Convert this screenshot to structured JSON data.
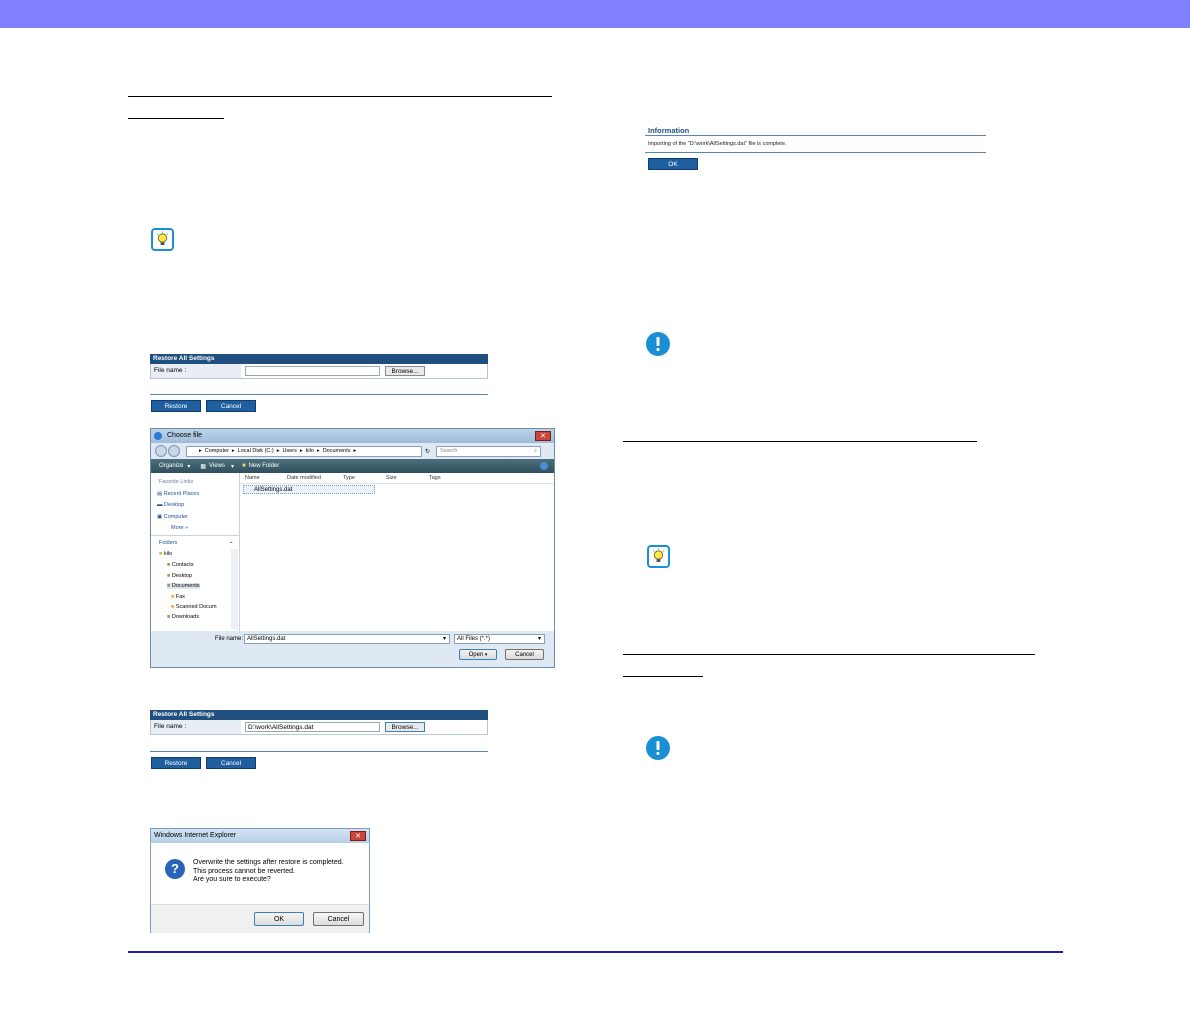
{
  "restore_panel_1": {
    "title": "Restore All Settings",
    "file_label": "File name :",
    "file_value": "",
    "browse": "Browse...",
    "restore": "Restore",
    "cancel": "Cancel"
  },
  "restore_panel_2": {
    "title": "Restore All Settings",
    "file_label": "File name :",
    "file_value": "D:\\work\\AllSettings.dat",
    "browse": "Browse...",
    "restore": "Restore",
    "cancel": "Cancel"
  },
  "file_dialog": {
    "title": "Choose file",
    "address": [
      "Computer",
      "Local Disk (C:)",
      "Users",
      "kilo",
      "Documents"
    ],
    "search_placeholder": "Search",
    "toolbar": {
      "organize": "Organize",
      "views": "Views",
      "new_folder": "New Folder"
    },
    "favorite_links_heading": "Favorite Links",
    "favorite_links": [
      "Recent Places",
      "Desktop",
      "Computer",
      "More"
    ],
    "folders_heading": "Folders",
    "folders": [
      "kilo",
      "Contacts",
      "Desktop",
      "Documents",
      "Fax",
      "Scanned Docum",
      "Downloads"
    ],
    "columns": [
      "Name",
      "Date modified",
      "Type",
      "Size",
      "Tags"
    ],
    "file_item": "AllSettings.dat",
    "file_name_label": "File name:",
    "file_name_value": "AllSettings.dat",
    "filter": "All Files (*.*)",
    "open": "Open",
    "cancel": "Cancel"
  },
  "ie_confirm": {
    "title": "Windows Internet Explorer",
    "lines": [
      "Overwrite the settings after restore is completed.",
      "This process cannot be reverted.",
      "Are you sure to execute?"
    ],
    "ok": "OK",
    "cancel": "Cancel"
  },
  "info_box": {
    "title": "Information",
    "message": "Importing of the \"D:\\work\\AllSettings.dat\" file is complete.",
    "ok": "OK"
  },
  "icons": {
    "tip": "lightbulb-icon",
    "important": "exclamation-icon",
    "question": "question-icon"
  },
  "colors": {
    "top_bar": "#8080ff",
    "panel_header": "#1f4f7f",
    "footer_rule": "#2020b0",
    "icon_blue": "#1a8fd6"
  }
}
